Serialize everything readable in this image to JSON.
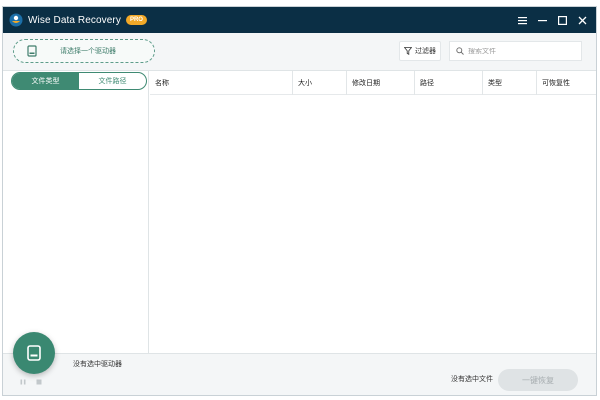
{
  "window": {
    "title": "Wise Data Recovery",
    "badge": "PRO"
  },
  "window_controls": [
    "menu-icon",
    "minimize-icon",
    "maximize-icon",
    "close-icon"
  ],
  "toolbar": {
    "drive_select_label": "请选择一个驱动器",
    "filter_label": "过滤器",
    "search_placeholder": "搜索文件"
  },
  "left_panel": {
    "tabs": [
      {
        "label": "文件类型",
        "active": true
      },
      {
        "label": "文件路径",
        "active": false
      }
    ]
  },
  "table": {
    "columns": [
      "名称",
      "大小",
      "修改日期",
      "路径",
      "类型",
      "可恢复性"
    ],
    "rows": []
  },
  "footer": {
    "no_drive_label": "没有选中驱动器",
    "no_file_label": "没有选中文件",
    "recover_button": "一键恢复"
  },
  "colors": {
    "titlebar": "#0b2f45",
    "accent": "#3f8a73",
    "badge": "#f2a928",
    "disabled_button": "#dfe3e5"
  }
}
